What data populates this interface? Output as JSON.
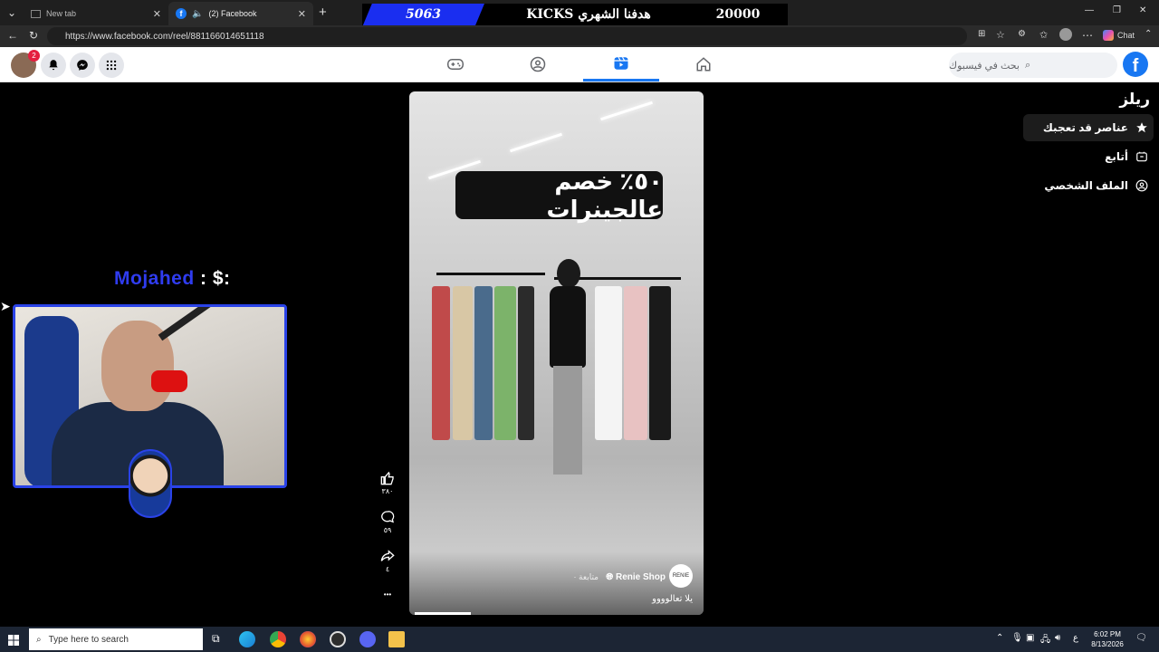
{
  "browser": {
    "tabs": [
      {
        "label": "New tab",
        "active": false
      },
      {
        "label": "(2) Facebook",
        "active": true
      }
    ],
    "new_tab_symbol": "+",
    "url": "https://www.facebook.com/reel/881166014651118",
    "chat_label": "Chat"
  },
  "banner": {
    "left_number": "5063",
    "title": "KICKS هدفنا الشهري",
    "right_number": "20000",
    "accent": "#1a2ef0"
  },
  "facebook": {
    "notification_count": "2",
    "search_placeholder": "بحث في فيسبوك",
    "nav_tabs": [
      {
        "name": "gaming",
        "active": false
      },
      {
        "name": "groups",
        "active": false
      },
      {
        "name": "reels",
        "active": true
      },
      {
        "name": "home",
        "active": false
      }
    ],
    "brand_color": "#1877f2"
  },
  "sidebar": {
    "title": "ريلز",
    "items": [
      {
        "label": "عناصر قد تعجبك",
        "icon": "star-icon",
        "selected": true
      },
      {
        "label": "أتابع",
        "icon": "following-icon",
        "selected": false
      },
      {
        "label": "الملف الشخصي",
        "icon": "profile-icon",
        "selected": false
      }
    ]
  },
  "webcam": {
    "name_prefix": "Mojahed",
    "name_suffix": " : $:"
  },
  "reel": {
    "promo_text": "٥٠٪ خصم عالجينرات",
    "shop_name": "Renie Shop",
    "follow_label": "متابعة ·",
    "caption": "يلا تعالوووو",
    "shop_avatar_text": "RENIE",
    "likes": "٣٨٠",
    "comments": "٥٩",
    "shares": "٤",
    "more_symbol": "•••",
    "progress": 0.19
  },
  "taskbar": {
    "search_placeholder": "Type here to search",
    "time": "6:02 PM",
    "date": "8/13/2026",
    "lang": "ع"
  }
}
